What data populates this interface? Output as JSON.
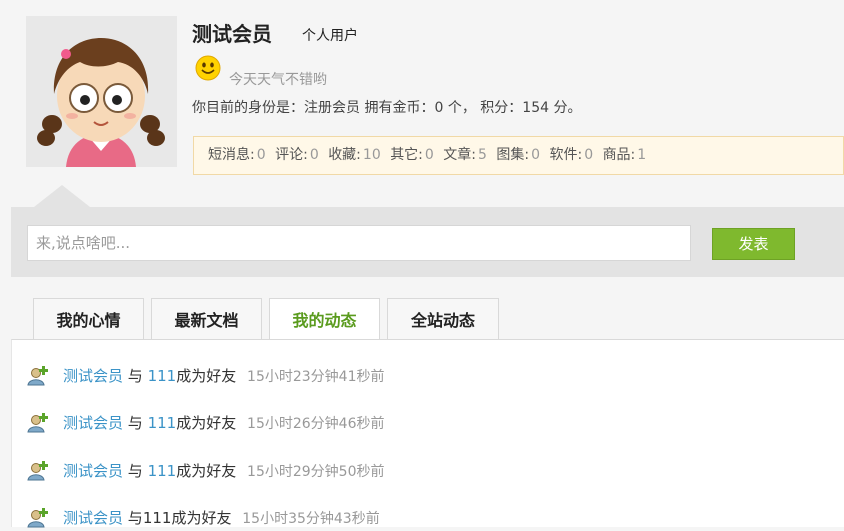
{
  "profile": {
    "username": "测试会员",
    "user_type": "个人用户",
    "mood_text": "今天天气不错哟",
    "identity": {
      "label": "你目前的身份是：",
      "role": "注册会员",
      "coins_label": "拥有金币：",
      "coins_value": "0",
      "coins_unit": "个，",
      "points_label": "积分：",
      "points_value": "154",
      "points_unit": "分。"
    }
  },
  "stats": [
    {
      "label": "短消息:",
      "value": "0"
    },
    {
      "label": "评论:",
      "value": "0"
    },
    {
      "label": "收藏:",
      "value": "10"
    },
    {
      "label": "其它:",
      "value": "0"
    },
    {
      "label": "文章:",
      "value": "5"
    },
    {
      "label": "图集:",
      "value": "0"
    },
    {
      "label": "软件:",
      "value": "0"
    },
    {
      "label": "商品:",
      "value": "1"
    }
  ],
  "post": {
    "placeholder": "来,说点啥吧...",
    "button": "发表"
  },
  "tabs": [
    {
      "label": "我的心情",
      "active": false
    },
    {
      "label": "最新文档",
      "active": false
    },
    {
      "label": "我的动态",
      "active": true
    },
    {
      "label": "全站动态",
      "active": false
    }
  ],
  "feed": [
    {
      "user": "测试会员",
      "conj": "与",
      "friend": "111",
      "action": "成为好友",
      "time": "15小时23分钟41秒前"
    },
    {
      "user": "测试会员",
      "conj": "与",
      "friend": "111",
      "action": "成为好友",
      "time": "15小时26分钟46秒前"
    },
    {
      "user": "测试会员",
      "conj": "与",
      "friend": "111",
      "action": "成为好友",
      "time": "15小时29分钟50秒前"
    },
    {
      "user": "测试会员",
      "conj": "与",
      "friend": "111",
      "action": "成为好友",
      "time": "15小时35分钟43秒前"
    }
  ],
  "colors": {
    "accent_green": "#7fb92e",
    "active_tab_text": "#5a9b1e",
    "link_blue": "#3b93c7",
    "stats_bg": "#fff8e8"
  },
  "icons": {
    "mood": "smiley-icon",
    "feed": "add-friend-icon"
  }
}
